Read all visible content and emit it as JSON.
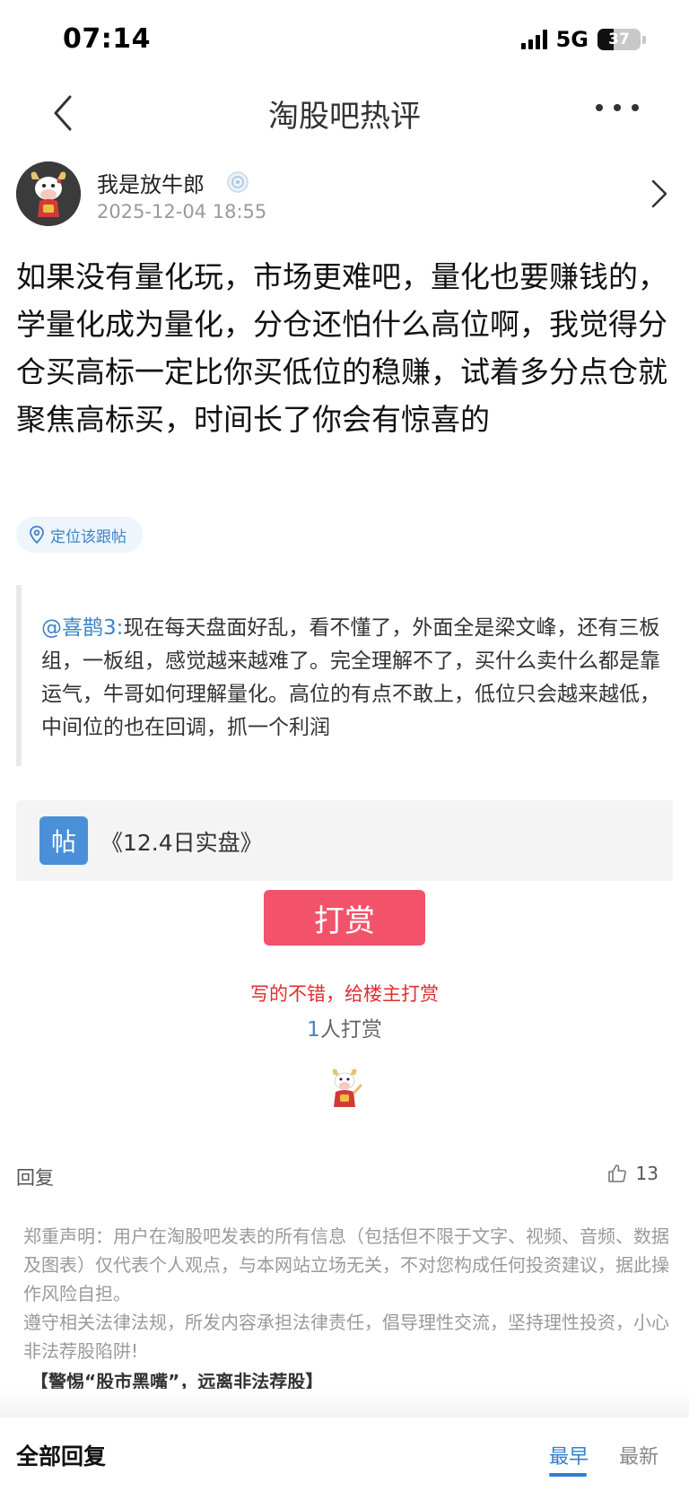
{
  "status_bar": {
    "time": "07:14",
    "network": "5G",
    "battery": "37",
    "battery_level": 0.37
  },
  "nav": {
    "title": "淘股吧热评"
  },
  "author": {
    "name": "我是放牛郎",
    "timestamp": "2025-12-04 18:55"
  },
  "post": {
    "content": "如果没有量化玩，市场更难吧，量化也要赚钱的，学量化成为量化，分仓还怕什么高位啊，我觉得分仓买高标一定比你买低位的稳赚，试着多分点仓就聚焦高标买，时间长了你会有惊喜的",
    "locate_label": "定位该跟帖"
  },
  "quote": {
    "mention": "@喜鹊3:",
    "text": "现在每天盘面好乱，看不懂了，外面全是梁文峰，还有三板组，一板组，感觉越来越难了。完全理解不了，买什么卖什么都是靠运气，牛哥如何理解量化。高位的有点不敢上，低位只会越来越低，中间位的也在回调，抓一个利润"
  },
  "linked_post": {
    "badge": "帖",
    "title": "《12.4日实盘》"
  },
  "reward": {
    "button_label": "打赏",
    "hint": "写的不错，给楼主打赏",
    "count": "1",
    "count_suffix": "人打赏"
  },
  "actions": {
    "reply_label": "回复",
    "like_count": "13"
  },
  "disclaimer": {
    "text": "郑重声明：用户在淘股吧发表的所有信息（包括但不限于文字、视频、音频、数据及图表）仅代表个人观点，与本网站立场无关，不对您构成任何投资建议，据此操作风险自担。\n遵守相关法律法规，所发内容承担法律责任，倡导理性交流，坚持理性投资，小心非法荐股陷阱!",
    "warning": "【警惕“股市黑嘴”，远离非法荐股】"
  },
  "footer": {
    "title": "全部回复",
    "sort_earliest": "最早",
    "sort_latest": "最新"
  },
  "colors": {
    "accent_blue": "#2f7fd3",
    "reward_red": "#f3536a",
    "hint_red": "#e02e2e"
  }
}
